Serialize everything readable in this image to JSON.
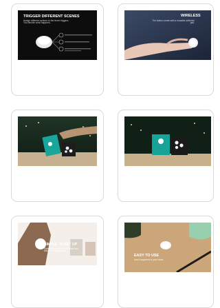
{
  "products": [
    {
      "caption_title": "TRIGGER DIFFERENT SCENES",
      "caption_sub": "Assign different actions to the three triggers. You decide what happens."
    },
    {
      "caption_title": "WIRELESS",
      "caption_sub": "The button comes with a reusable adhesive pad."
    },
    {
      "caption_title": "",
      "caption_sub": ""
    },
    {
      "caption_title": "",
      "caption_sub": ""
    },
    {
      "caption_title": "SIMPLE TO SET UP",
      "caption_sub": "Connect your hub to the button and choose what happens."
    },
    {
      "caption_title": "EASY TO USE",
      "caption_sub": "Use it anywhere in your home."
    }
  ]
}
